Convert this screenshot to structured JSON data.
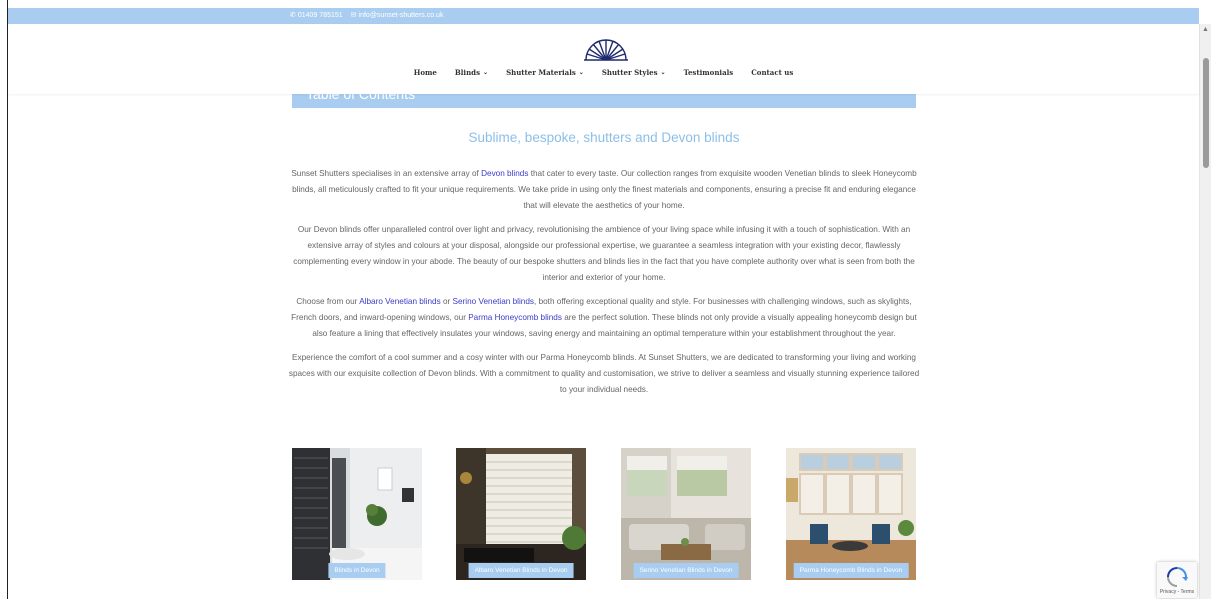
{
  "topbar": {
    "phone": "01409 785151",
    "email": "info@sunset-shutters.co.uk"
  },
  "nav": {
    "items": [
      {
        "label": "Home",
        "dropdown": false
      },
      {
        "label": "Blinds",
        "dropdown": true
      },
      {
        "label": "Shutter Materials",
        "dropdown": true
      },
      {
        "label": "Shutter Styles",
        "dropdown": true
      },
      {
        "label": "Testimonials",
        "dropdown": false
      },
      {
        "label": "Contact us",
        "dropdown": false
      }
    ]
  },
  "toc": {
    "title": "Table of Contents",
    "toggle": "⌃"
  },
  "main": {
    "heading": "Sublime, bespoke, shutters and Devon blinds",
    "p1": {
      "a": "Sunset Shutters specialises in an extensive array of ",
      "link": "Devon blinds",
      "b": " that cater to every taste. Our collection ranges from exquisite wooden Venetian blinds to sleek Honeycomb blinds, all meticulously crafted to fit your unique requirements. We take pride in using only the finest materials and components, ensuring a precise fit and enduring elegance that will elevate the aesthetics of your home."
    },
    "p2": "Our Devon blinds offer unparalleled control over light and privacy, revolutionising the ambience of your living space while infusing it with a touch of sophistication. With an extensive array of styles and colours at your disposal, alongside our professional expertise, we guarantee a seamless integration with your existing decor, flawlessly complementing every window in your abode. The beauty of our bespoke shutters and blinds lies in the fact that you have complete authority over what is seen from both the interior and exterior of your home.",
    "p3": {
      "a": "Choose from our ",
      "link1": "Albaro Venetian blinds",
      "b": " or ",
      "link2": "Serino Venetian blinds",
      "c": ", both offering exceptional quality and style. For businesses with challenging windows, such as skylights, French doors, and inward-opening windows, our ",
      "link3": "Parma Honeycomb blinds",
      "d": " are the perfect solution. These blinds not only provide a visually appealing honeycomb design but also feature a lining that effectively insulates your windows, saving energy and maintaining an optimal temperature within your establishment throughout the year."
    },
    "p4": "Experience the comfort of a cool summer and a cosy winter with our Parma Honeycomb blinds. At Sunset Shutters, we are dedicated to transforming your living and working spaces with our exquisite collection of Devon blinds. With a commitment to quality and customisation, we strive to deliver a seamless and visually stunning experience tailored to your individual needs."
  },
  "gallery": [
    {
      "label": "Blinds in Devon"
    },
    {
      "label": "Albaro Venetian Blinds in Devon"
    },
    {
      "label": "Serino Venetian Blinds in Devon"
    },
    {
      "label": "Parma Honeycomb Blinds in Devon"
    }
  ],
  "recaptcha": {
    "label": "Privacy - Terms"
  },
  "colors": {
    "accent": "#a8cdf0",
    "heading": "#8cbfe8",
    "link": "#3c3cc8",
    "text": "#666666"
  }
}
